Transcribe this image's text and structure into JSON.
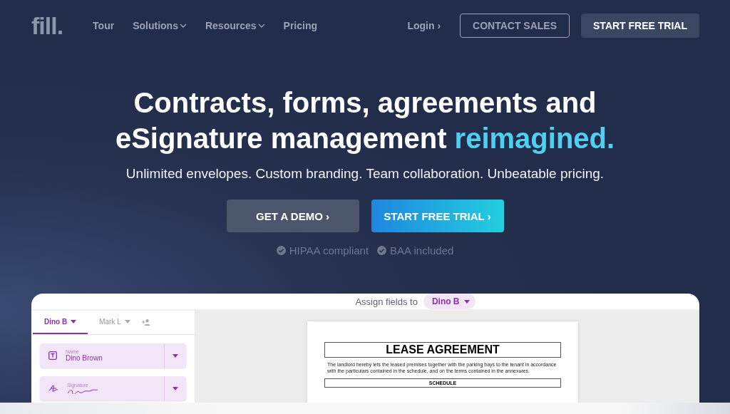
{
  "nav": {
    "logo": "fill.",
    "links": [
      {
        "label": "Tour",
        "dropdown": false
      },
      {
        "label": "Solutions",
        "dropdown": true
      },
      {
        "label": "Resources",
        "dropdown": true
      },
      {
        "label": "Pricing",
        "dropdown": false
      }
    ],
    "login": "Login ›",
    "contact": "CONTACT SALES",
    "trial": "START FREE TRIAL"
  },
  "hero": {
    "headline": "Contracts, forms, agreements and",
    "headline2": "eSignature management",
    "highlight": "reimagined.",
    "subtitle": "Unlimited envelopes. Custom branding. Team collaboration. Unbeatable pricing.",
    "demo": "GET A DEMO ›",
    "trial": "START FREE TRIAL ›",
    "badges": [
      "HIPAA compliant",
      "BAA included"
    ]
  },
  "app": {
    "assign_label": "Assign fields to",
    "assignee": "Dino B",
    "tabs": [
      {
        "label": "Dino B",
        "selected": true
      },
      {
        "label": "Mark L",
        "selected": false
      }
    ],
    "fields": [
      {
        "kind": "text",
        "label": "Name",
        "value": "Dino Brown"
      },
      {
        "kind": "signature",
        "label": "Signature"
      }
    ],
    "doc": {
      "title": "LEASE AGREEMENT",
      "body": "The landlord hereby lets the leased premises together with the parking bays to the tenant in accordance with the particulars contained in the schedule, and on the terms contained in the annexures.",
      "section": "SCHEDULE"
    }
  }
}
